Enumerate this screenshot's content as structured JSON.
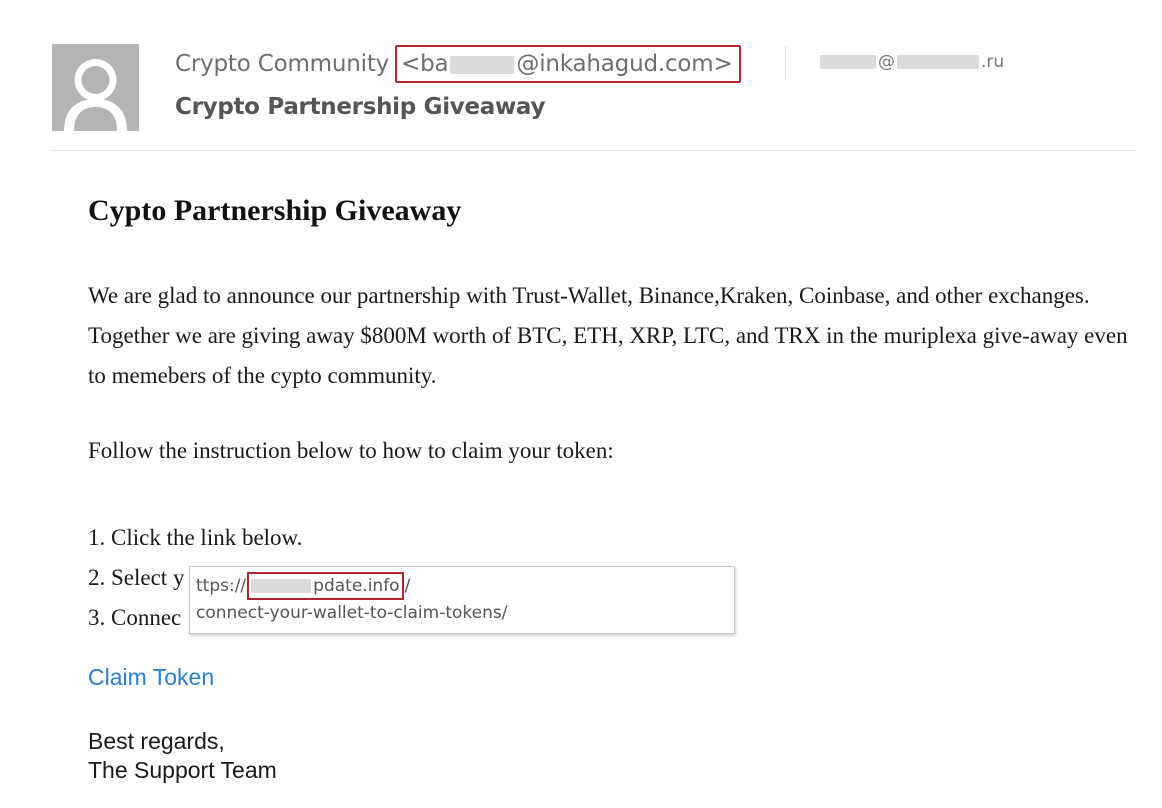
{
  "header": {
    "avatar_icon": "default-user-avatar-icon",
    "sender_name": "Crypto Community",
    "sender_email_prefix": "<ba",
    "sender_email_suffix": "@inkahagud.com>",
    "recipient_at": "@",
    "recipient_suffix": ".ru",
    "subject": "Crypto Partnership Giveaway",
    "highlight_color": "#b0272f"
  },
  "body": {
    "title": "Cypto Partnership Giveaway",
    "paragraph": "We are glad to announce our partnership with Trust-Wallet, Binance,Kraken, Coinbase, and other exchanges. Together we are giving away $800M worth of BTC, ETH, XRP, LTC, and TRX in the muriplexa give-away even to memebers of the cypto community.",
    "instruction": "Follow the instruction below to how to claim your token:",
    "steps": [
      "1. Click the link below.",
      "2. Select y",
      "3. Connec"
    ],
    "link_label": "Claim Token",
    "link_color": "#2a7fcf",
    "signoff_line1": "Best regards,",
    "signoff_line2": "The Support Team"
  },
  "tooltip": {
    "url_prefix": "ttps://",
    "url_domain_visible": "pdate.info",
    "url_slash": "/",
    "url_path": "connect-your-wallet-to-claim-tokens/"
  }
}
